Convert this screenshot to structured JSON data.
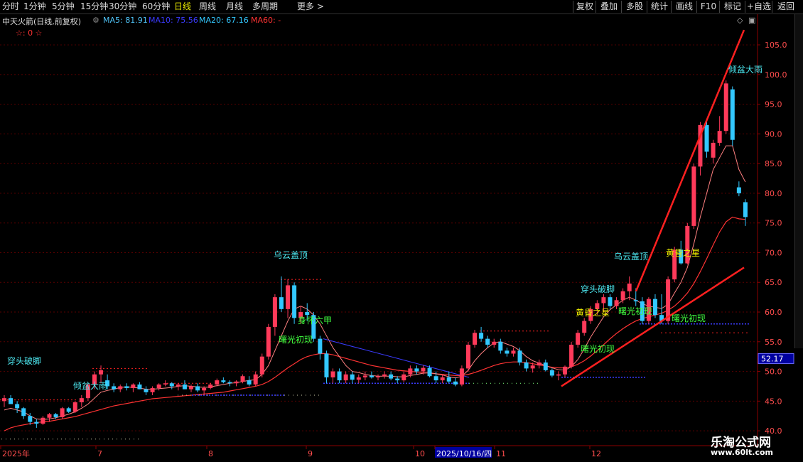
{
  "toolbar": {
    "periods": [
      "分时",
      "1分钟",
      "5分钟",
      "15分钟",
      "30分钟",
      "60分钟",
      "日线",
      "周线",
      "月线",
      "多周期",
      "更多 >"
    ],
    "active_period": "日线",
    "right_buttons": [
      "复权",
      "叠加",
      "多股",
      "统计",
      "画线",
      "F10",
      "标记",
      "+自选",
      "返回"
    ]
  },
  "legend": {
    "stock": "中天火箭(日线,前复权)",
    "ma5_label": "MA5: 81.91",
    "ma10_label": "MA10: 75.56",
    "ma20_label": "MA20: 67.16",
    "ma60_label": "MA60: -",
    "stars": "☆: 0 ☆",
    "colors": {
      "ma5": "#4fc3f7",
      "ma10": "#3b3bff",
      "ma20": "#33c8ff",
      "ma60": "#ff3333"
    }
  },
  "price_axis": {
    "ticks": [
      "105.0",
      "100.0",
      "95.0",
      "90.0",
      "85.0",
      "80.0",
      "75.0",
      "70.0",
      "65.0",
      "60.0",
      "55.0",
      "50.0",
      "45.0",
      "40.0"
    ],
    "current_price_box": "52.17"
  },
  "date_axis": {
    "labels": [
      "2025年",
      "7",
      "8",
      "9",
      "10",
      "2025/10/16/四",
      "11",
      "12"
    ]
  },
  "annotations": [
    {
      "text": "乌云盖顶",
      "color": "#4de8f0"
    },
    {
      "text": "身怀六甲",
      "color": "#40ff40"
    },
    {
      "text": "曙光初现",
      "color": "#40ff40"
    },
    {
      "text": "倾盆大雨",
      "color": "#4de8f0"
    },
    {
      "text": "穿头破脚",
      "color": "#4de8f0"
    },
    {
      "text": "乌云盖顶",
      "color": "#4de8f0"
    },
    {
      "text": "穿头破脚",
      "color": "#4de8f0"
    },
    {
      "text": "黄昏之星",
      "color": "#f0f000"
    },
    {
      "text": "曙光初现",
      "color": "#40ff40"
    },
    {
      "text": "曙光初现",
      "color": "#40ff40"
    },
    {
      "text": "黄昏之星",
      "color": "#f0f000"
    },
    {
      "text": "曙光初现",
      "color": "#40ff40"
    },
    {
      "text": "倾盆大雨",
      "color": "#4de8f0"
    }
  ],
  "watermark": {
    "line1": "乐淘公式网",
    "line2": "www.60lt.com"
  },
  "chart_data": {
    "type": "candlestick",
    "ylim": [
      37.5,
      108.0
    ],
    "colors": {
      "up": "#ff3a5a",
      "down": "#33c8ff",
      "doji": "#ffffff"
    },
    "candles": [
      [
        45,
        46,
        44,
        45.5
      ],
      [
        45.5,
        46,
        44.5,
        44.5
      ],
      [
        44.5,
        45,
        43,
        43.8
      ],
      [
        43.8,
        44,
        42,
        42.5
      ],
      [
        42.5,
        43,
        41,
        41.5
      ],
      [
        41.5,
        42,
        40.5,
        41.2
      ],
      [
        41.2,
        42.5,
        41,
        42.2
      ],
      [
        42.2,
        43,
        41.5,
        42.8
      ],
      [
        42.8,
        43,
        42,
        42.3
      ],
      [
        42.3,
        44,
        42,
        43.8
      ],
      [
        43.8,
        44,
        43,
        43.2
      ],
      [
        43.2,
        45,
        43,
        44.8
      ],
      [
        44.8,
        46,
        44,
        45.5
      ],
      [
        45.5,
        48,
        45,
        47.8
      ],
      [
        47.8,
        50,
        47,
        49.5
      ],
      [
        49.5,
        51,
        48,
        50.2
      ],
      [
        48.5,
        49.5,
        47,
        47.5
      ],
      [
        47.5,
        48,
        46.5,
        47
      ],
      [
        47,
        47.8,
        46.5,
        47.5
      ],
      [
        47.5,
        48,
        46.8,
        47.2
      ],
      [
        47.2,
        48,
        46.5,
        47.8
      ],
      [
        47.8,
        48.2,
        47,
        47
      ],
      [
        47,
        47.5,
        46,
        46.5
      ],
      [
        46.5,
        47.5,
        46,
        47.2
      ],
      [
        47.2,
        48,
        46.8,
        47.8
      ],
      [
        47.8,
        48.5,
        47.5,
        48
      ],
      [
        48,
        48.2,
        47,
        47.5
      ],
      [
        47.5,
        48,
        46.8,
        47.8
      ],
      [
        47.8,
        48.5,
        47,
        47
      ],
      [
        47,
        47.8,
        46.5,
        47.5
      ],
      [
        47.5,
        48,
        46.5,
        46.8
      ],
      [
        46.8,
        47.5,
        46,
        47.2
      ],
      [
        47.2,
        48,
        47,
        47.8
      ],
      [
        47.8,
        48.8,
        47.5,
        48.5
      ],
      [
        48.5,
        49,
        48,
        48.2
      ],
      [
        48.2,
        48.5,
        47.5,
        48
      ],
      [
        48,
        48.5,
        47.5,
        48.3
      ],
      [
        48.3,
        49.5,
        48,
        49.2
      ],
      [
        48.5,
        49.2,
        47.5,
        47.8
      ],
      [
        47.8,
        50,
        47.5,
        49.5
      ],
      [
        49.5,
        53,
        49,
        52.5
      ],
      [
        52.5,
        58,
        52,
        57.5
      ],
      [
        57.5,
        63,
        56,
        62.5
      ],
      [
        62.5,
        66,
        60,
        60.5
      ],
      [
        60.5,
        65.5,
        59,
        64.5
      ],
      [
        64.5,
        65,
        58,
        59
      ],
      [
        59,
        61,
        58,
        60
      ],
      [
        60,
        61.5,
        58.5,
        59.5
      ],
      [
        59.5,
        60,
        55,
        55.5
      ],
      [
        55.5,
        56,
        52,
        53
      ],
      [
        53,
        53.5,
        48,
        49
      ],
      [
        49,
        50.5,
        48,
        50
      ],
      [
        50,
        50.5,
        48,
        48.5
      ],
      [
        48.5,
        50,
        48,
        49.5
      ],
      [
        49.5,
        50,
        48,
        48.6
      ],
      [
        48.6,
        49.5,
        48,
        49
      ],
      [
        49,
        50,
        48.5,
        49.3
      ],
      [
        49.3,
        50,
        48.8,
        49
      ],
      [
        49,
        49.5,
        48.5,
        49.2
      ],
      [
        49.2,
        50,
        48.8,
        49.5
      ],
      [
        49.5,
        50,
        48.5,
        48.8
      ],
      [
        48.8,
        49.2,
        48,
        48.5
      ],
      [
        48.5,
        50,
        48.2,
        49.5
      ],
      [
        49.5,
        51,
        49,
        50.5
      ],
      [
        50.5,
        51,
        49.5,
        50
      ],
      [
        50,
        51,
        49.5,
        50.6
      ],
      [
        50.6,
        51,
        49,
        49.2
      ],
      [
        49.2,
        50,
        48,
        48.5
      ],
      [
        48.5,
        49.5,
        48,
        49
      ],
      [
        49,
        50,
        48,
        48.3
      ],
      [
        48.3,
        49,
        47.5,
        47.8
      ],
      [
        47.8,
        51,
        47.5,
        50.5
      ],
      [
        50.5,
        55,
        50,
        54.5
      ],
      [
        54.5,
        57,
        54,
        56.5
      ],
      [
        56.5,
        57.5,
        55,
        55.5
      ],
      [
        55.5,
        56,
        54,
        54.5
      ],
      [
        54.5,
        55.5,
        54,
        55
      ],
      [
        55,
        55.5,
        53,
        53.5
      ],
      [
        53.5,
        54,
        52.5,
        53
      ],
      [
        53,
        54,
        52.5,
        53.5
      ],
      [
        53.5,
        54,
        51,
        51.5
      ],
      [
        51.5,
        52,
        50,
        50.5
      ],
      [
        50.5,
        51.5,
        49.8,
        51
      ],
      [
        51,
        52,
        50.5,
        51.5
      ],
      [
        51.5,
        52,
        50,
        50.2
      ],
      [
        50.2,
        50.5,
        49,
        49.3
      ],
      [
        49.3,
        50,
        48.5,
        49.5
      ],
      [
        49.5,
        51,
        49,
        50.8
      ],
      [
        50.8,
        55,
        50.5,
        54.5
      ],
      [
        54.5,
        57,
        54,
        56.5
      ],
      [
        56.5,
        59,
        56,
        58.5
      ],
      [
        58.5,
        61,
        58,
        60.5
      ],
      [
        60.5,
        62,
        59.5,
        61.5
      ],
      [
        61.5,
        63,
        60,
        62.5
      ],
      [
        62.5,
        63,
        60.5,
        61
      ],
      [
        61,
        62.5,
        60.5,
        62
      ],
      [
        62,
        64,
        61.5,
        63.5
      ],
      [
        63.5,
        66,
        62,
        64.8
      ],
      [
        62,
        64,
        61,
        61.8
      ],
      [
        61.8,
        62.5,
        58,
        58.5
      ],
      [
        58.5,
        62.5,
        58,
        62.2
      ],
      [
        62.2,
        63,
        59,
        59.5
      ],
      [
        59.5,
        63,
        58,
        58.5
      ],
      [
        58.5,
        66,
        58,
        65.5
      ],
      [
        65.5,
        71,
        65,
        70.5
      ],
      [
        70.5,
        72,
        68,
        68.2
      ],
      [
        68.2,
        75,
        68,
        74.5
      ],
      [
        74.5,
        85,
        74,
        84.5
      ],
      [
        84.5,
        92,
        83,
        91.5
      ],
      [
        91.5,
        92.5,
        86,
        87
      ],
      [
        86,
        89,
        85,
        88.5
      ],
      [
        88.5,
        93,
        88,
        90.5
      ],
      [
        90.5,
        99,
        90,
        98.5
      ],
      [
        97.5,
        98,
        88,
        89
      ],
      [
        81,
        82,
        79.5,
        80
      ],
      [
        78.5,
        79,
        74.5,
        76
      ]
    ],
    "ma_short": [
      43.5,
      43.8,
      43.5,
      43.2,
      42.5,
      42,
      41.9,
      42,
      42.2,
      42.5,
      42.8,
      43.2,
      43.8,
      44.5,
      45.5,
      46.5,
      46.8,
      47,
      47.3,
      47.4,
      47.3,
      47.2,
      47,
      47,
      47.1,
      47.2,
      47.3,
      47.5,
      47.6,
      47.5,
      47.4,
      47.3,
      47.4,
      47.6,
      47.8,
      48,
      48.1,
      48.3,
      48.5,
      48.6,
      49.5,
      51,
      53.5,
      56,
      58.5,
      60.5,
      61,
      60.5,
      59.5,
      58,
      56,
      54,
      52.5,
      51,
      50,
      49.8,
      49.5,
      49.3,
      49.2,
      49.2,
      49.2,
      49.1,
      49.1,
      49.3,
      49.5,
      49.7,
      49.8,
      49.6,
      49.4,
      49.1,
      48.9,
      49.2,
      50.2,
      51.8,
      53,
      54,
      54.8,
      55,
      54.6,
      54.2,
      53.5,
      52.5,
      51.8,
      51.4,
      51,
      50.6,
      50.3,
      50.2,
      50.8,
      52,
      53.8,
      55.8,
      57.5,
      59.2,
      60.4,
      61.2,
      62,
      62.5,
      62,
      61.4,
      61,
      60.8,
      60.6,
      61.3,
      63.2,
      65,
      67.5,
      71.5,
      76,
      80,
      84,
      86,
      88,
      88,
      84,
      81.9
    ],
    "ma_mid": [
      40,
      40.5,
      40.8,
      41,
      41.2,
      41.4,
      41.5,
      41.6,
      41.8,
      42,
      42.2,
      42.4,
      42.7,
      43,
      43.3,
      43.6,
      43.9,
      44.2,
      44.4,
      44.6,
      44.8,
      45,
      45.2,
      45.4,
      45.5,
      45.6,
      45.7,
      45.8,
      45.9,
      46,
      46.1,
      46.2,
      46.3,
      46.4,
      46.5,
      46.7,
      46.9,
      47.1,
      47.3,
      47.5,
      47.8,
      48.3,
      49,
      49.8,
      50.6,
      51.3,
      52,
      52.5,
      52.8,
      53,
      53,
      52.8,
      52.5,
      52.2,
      51.9,
      51.6,
      51.3,
      51,
      50.8,
      50.6,
      50.4,
      50.2,
      50.1,
      50,
      49.9,
      49.8,
      49.7,
      49.6,
      49.5,
      49.4,
      49.3,
      49.3,
      49.5,
      49.8,
      50.2,
      50.6,
      51,
      51.3,
      51.5,
      51.6,
      51.6,
      51.5,
      51.3,
      51.1,
      50.9,
      50.7,
      50.6,
      50.6,
      50.8,
      51.2,
      51.8,
      52.6,
      53.5,
      54.5,
      55.5,
      56.4,
      57.2,
      57.9,
      58.5,
      58.9,
      59.2,
      59.5,
      59.8,
      60.3,
      61,
      62,
      63.2,
      64.8,
      66.8,
      69,
      71.3,
      73.5,
      75.2,
      76,
      75.7,
      75.6
    ]
  }
}
